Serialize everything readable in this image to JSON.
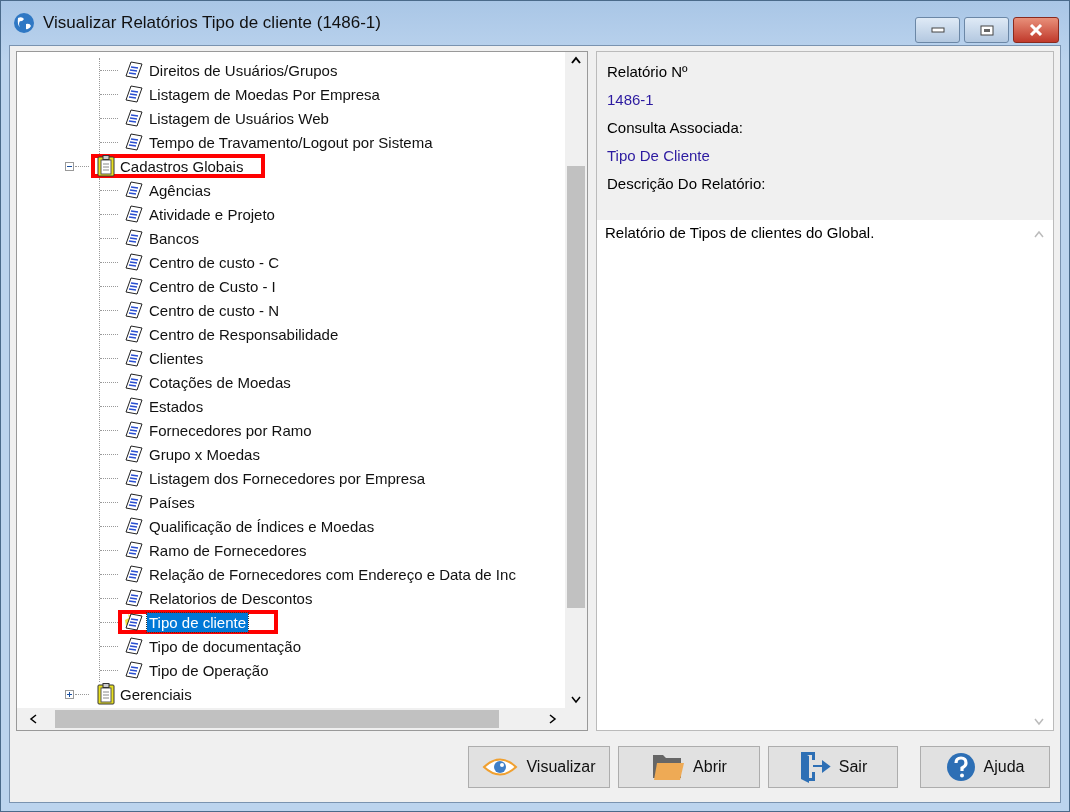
{
  "window": {
    "title": "Visualizar Relatórios Tipo de cliente (1486-1)"
  },
  "tree": [
    {
      "kind": "group_tail",
      "children": [
        {
          "label": "Direitos de Usuários/Grupos",
          "selected": false,
          "marked": false
        },
        {
          "label": "Listagem de Moedas Por Empresa",
          "selected": false,
          "marked": false
        },
        {
          "label": "Listagem de Usuários Web",
          "selected": false,
          "marked": false
        },
        {
          "label": "Tempo de Travamento/Logout por Sistema",
          "selected": false,
          "marked": false
        }
      ]
    },
    {
      "kind": "group",
      "label": "Cadastros Globais",
      "expanded": true,
      "marked": true,
      "children": [
        {
          "label": "Agências",
          "selected": false,
          "marked": false
        },
        {
          "label": "Atividade e Projeto",
          "selected": false,
          "marked": false
        },
        {
          "label": "Bancos",
          "selected": false,
          "marked": false
        },
        {
          "label": "Centro de custo - C",
          "selected": false,
          "marked": false
        },
        {
          "label": "Centro de Custo - I",
          "selected": false,
          "marked": false
        },
        {
          "label": "Centro de custo - N",
          "selected": false,
          "marked": false
        },
        {
          "label": "Centro de Responsabilidade",
          "selected": false,
          "marked": false
        },
        {
          "label": "Clientes",
          "selected": false,
          "marked": false
        },
        {
          "label": "Cotações de Moedas",
          "selected": false,
          "marked": false
        },
        {
          "label": "Estados",
          "selected": false,
          "marked": false
        },
        {
          "label": "Fornecedores por Ramo",
          "selected": false,
          "marked": false
        },
        {
          "label": "Grupo x Moedas",
          "selected": false,
          "marked": false
        },
        {
          "label": "Listagem dos Fornecedores por Empresa",
          "selected": false,
          "marked": false
        },
        {
          "label": "Países",
          "selected": false,
          "marked": false
        },
        {
          "label": "Qualificação de Índices e Moedas",
          "selected": false,
          "marked": false
        },
        {
          "label": "Ramo de Fornecedores",
          "selected": false,
          "marked": false
        },
        {
          "label": "Relação de Fornecedores com Endereço e Data de Inc",
          "selected": false,
          "marked": false
        },
        {
          "label": "Relatorios de Descontos",
          "selected": false,
          "marked": false
        },
        {
          "label": "Tipo de cliente",
          "selected": true,
          "marked": true
        },
        {
          "label": "Tipo de documentação",
          "selected": false,
          "marked": false
        },
        {
          "label": "Tipo de Operação",
          "selected": false,
          "marked": false
        }
      ]
    },
    {
      "kind": "group",
      "label": "Gerenciais",
      "expanded": false,
      "marked": false
    }
  ],
  "details": {
    "report_label": "Relatório Nº",
    "report_number": "1486-1",
    "query_label": "Consulta Associada:",
    "query_value": "Tipo De Cliente",
    "description_label": "Descrição Do Relatório:",
    "description": "Relatório de Tipos de clientes do Global."
  },
  "buttons": [
    {
      "kind": "view",
      "label": "Visualizar"
    },
    {
      "kind": "open",
      "label": "Abrir"
    },
    {
      "kind": "exit",
      "label": "Sair"
    },
    {
      "kind": "help",
      "label": "Ajuda"
    }
  ]
}
